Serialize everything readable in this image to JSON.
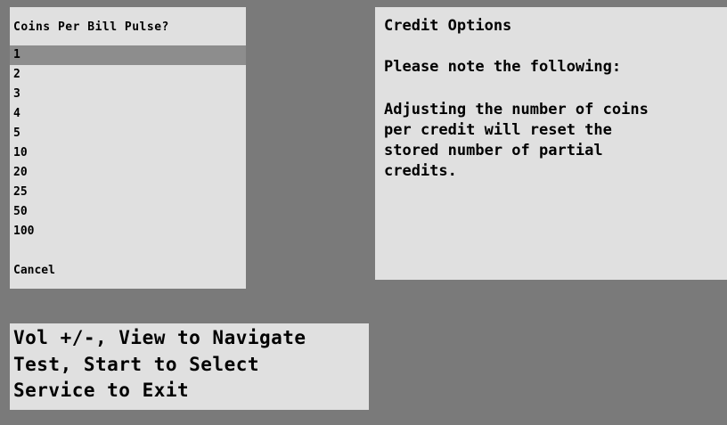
{
  "menu": {
    "title": "Coins Per Bill Pulse?",
    "selected_index": 0,
    "items": [
      "1",
      "2",
      "3",
      "4",
      "5",
      "10",
      "20",
      "25",
      "50",
      "100"
    ],
    "cancel": "Cancel"
  },
  "info": {
    "title": "Credit Options",
    "note": "Please note the following:",
    "message_lines": [
      "Adjusting the number of coins",
      "per credit will reset the",
      "stored number of partial",
      "credits."
    ]
  },
  "help": {
    "lines": [
      "Vol +/-, View to Navigate",
      "Test, Start to Select",
      "Service to Exit"
    ]
  },
  "colors": {
    "background": "#7a7a7a",
    "panel": "#e0e0e0",
    "selection": "#8d8d8d"
  }
}
